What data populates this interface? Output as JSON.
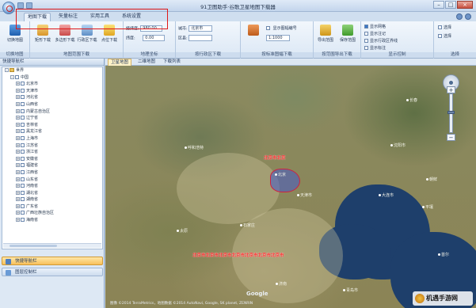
{
  "window": {
    "title": "91卫图助手·谷歌卫星地图下载器",
    "min_glyph": "–",
    "max_glyph": "□",
    "close_glyph": "×"
  },
  "ribbon_tabs": [
    "地图下载",
    "矢量标注",
    "实用工具",
    "系统设置"
  ],
  "ribbon": {
    "groups": [
      {
        "label": "切换地图",
        "buttons": [
          "切换地图"
        ]
      },
      {
        "label": "地图范围下载",
        "buttons": [
          "矩形下载",
          "多边形下载",
          "行政区下载",
          "点位下载"
        ]
      },
      {
        "label": "地理坐标",
        "rows": [
          "经纬度:",
          "纬度:"
        ],
        "values": [
          "980.00",
          "0.00"
        ]
      },
      {
        "label": "按行政区下载",
        "rows": [
          "城市:",
          "区县:"
        ],
        "values": [
          "北京市",
          ""
        ]
      },
      {
        "label": "按标准图幅下载",
        "rows": [
          "显示图幅编号",
          "1:1000"
        ]
      },
      {
        "label": "按范围导出下载",
        "buttons": [
          "导出范围",
          "保存范围"
        ]
      },
      {
        "label": "显示控制",
        "checks": [
          "显示网格",
          "显示注记",
          "显示行政区界线",
          "显示标注"
        ]
      },
      {
        "label": "选择",
        "checks": [
          "选择",
          "选择"
        ]
      }
    ]
  },
  "left_panel": {
    "title": "快捷导航栏",
    "root": "世界",
    "country": "中国",
    "provinces": [
      "北京市",
      "天津市",
      "河北省",
      "山西省",
      "内蒙古自治区",
      "辽宁省",
      "吉林省",
      "黑龙江省",
      "上海市",
      "江苏省",
      "浙江省",
      "安徽省",
      "福建省",
      "江西省",
      "山东省",
      "河南省",
      "湖北省",
      "湖南省",
      "广东省",
      "广西壮族自治区",
      "海南省"
    ],
    "nav_buttons": [
      "快捷导航栏",
      "图层控制栏"
    ]
  },
  "map_tabs": [
    "卫星地图",
    "二维地图",
    "下载列表"
  ],
  "map": {
    "cities": [
      {
        "name": "北京",
        "pos": "beijing"
      },
      {
        "name": "天津市",
        "pos": "tianjin"
      },
      {
        "name": "石家庄",
        "pos": "shijiazhuang"
      },
      {
        "name": "太原",
        "pos": "taiyuan"
      },
      {
        "name": "呼和浩特",
        "pos": "hohhot"
      },
      {
        "name": "沈阳市",
        "pos": "shenyang"
      },
      {
        "name": "长春",
        "pos": "changchun"
      },
      {
        "name": "大连市",
        "pos": "dalian"
      },
      {
        "name": "济南",
        "pos": "jinan"
      },
      {
        "name": "青岛市",
        "pos": "qingdao"
      },
      {
        "name": "朝鲜",
        "pos": "korea"
      },
      {
        "name": "平壤",
        "pos": "pyongyang"
      },
      {
        "name": "首尔",
        "pos": "seoul"
      }
    ],
    "red_label_top": "北京市北京",
    "red_label_bottom": "北京市北京市北京市北京市北京市北京市北京市",
    "google": "Google",
    "footer": "图像 ©2014 TerraMetrics，地图数据 ©2014 AutoNavi, Google, SK planet, ZENRIN",
    "watermark": "机遇手游网"
  },
  "colors": {
    "accent": "#e01818",
    "ribbon": "#dbe7f5",
    "sea": "#1e3f6b"
  }
}
